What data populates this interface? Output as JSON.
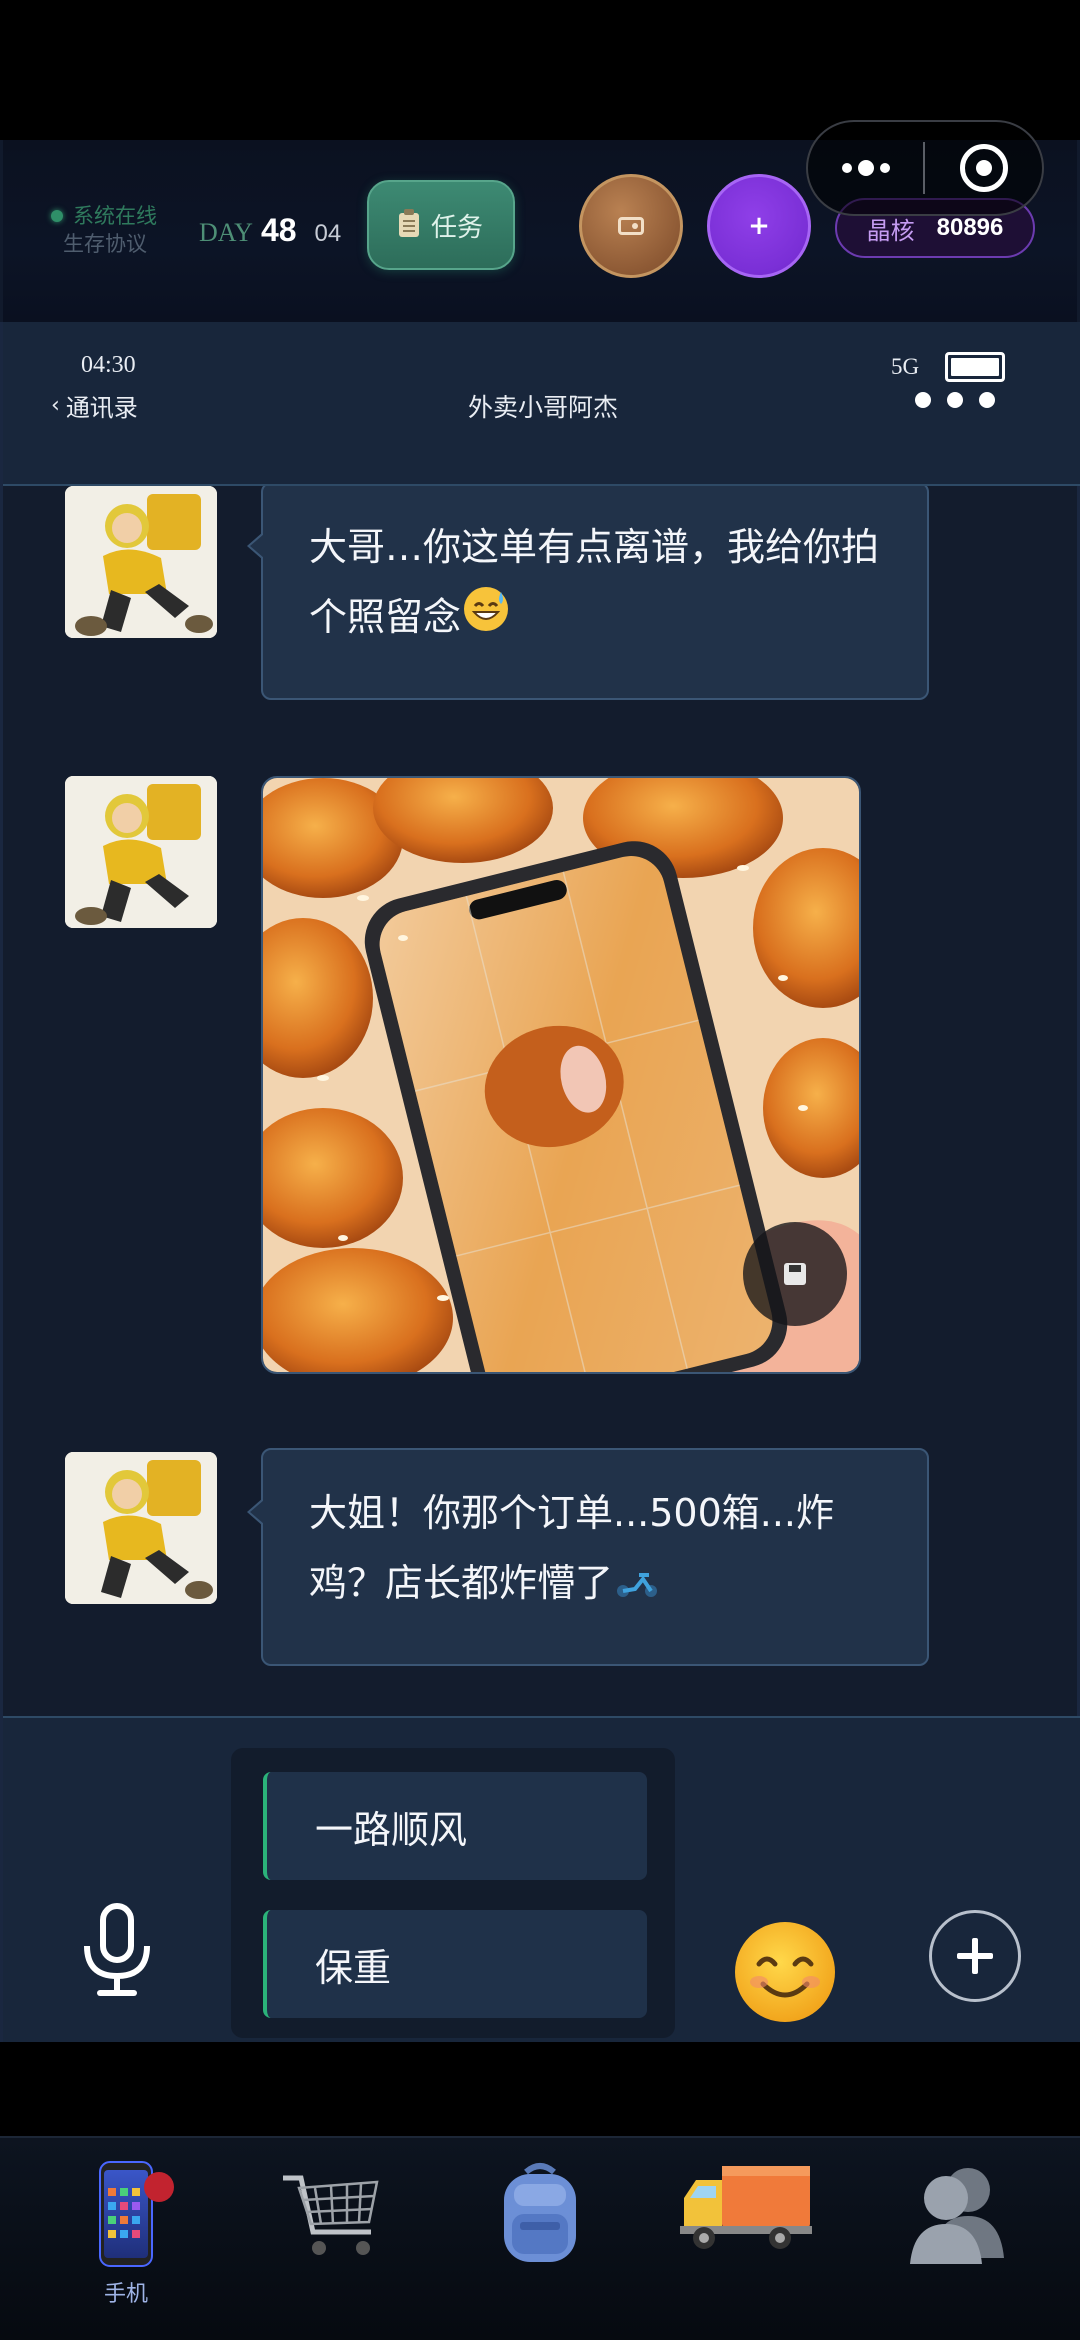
{
  "topbar": {
    "system_status": "系统在线",
    "protocol": "生存协议",
    "day_label": "DAY",
    "day_number": "48",
    "day_sub": "04",
    "task_button": "任务",
    "plus_button": "+",
    "crystal_label": "晶核",
    "crystal_value": "80896"
  },
  "phone_status": {
    "time": "04:30",
    "network": "5G",
    "back_label": "通讯录",
    "contact_name": "外卖小哥阿杰"
  },
  "messages": [
    {
      "type": "text",
      "sender": "外卖小哥阿杰",
      "text": "大哥…你这单有点离谱，我给你拍个照留念",
      "emoji": "sweat-smile"
    },
    {
      "type": "image",
      "sender": "外卖小哥阿杰",
      "image": "fried-chicken-photo"
    },
    {
      "type": "text",
      "sender": "外卖小哥阿杰",
      "text": "大姐！你那个订单...500箱...炸鸡？店长都炸懵了",
      "emoji": "scooter"
    }
  ],
  "quick_replies": [
    "一路顺风",
    "保重"
  ],
  "bottom_nav": {
    "items": [
      {
        "label": "手机",
        "icon": "phone-icon",
        "active": true,
        "badge": true
      },
      {
        "label": "",
        "icon": "shopping-cart-icon"
      },
      {
        "label": "",
        "icon": "backpack-icon"
      },
      {
        "label": "",
        "icon": "delivery-truck-icon"
      },
      {
        "label": "",
        "icon": "contacts-icon"
      }
    ]
  },
  "colors": {
    "accent_green": "#2bb37a",
    "accent_purple": "#7a2fd6",
    "bubble_bg": "#213249",
    "badge_red": "#c2232f"
  }
}
